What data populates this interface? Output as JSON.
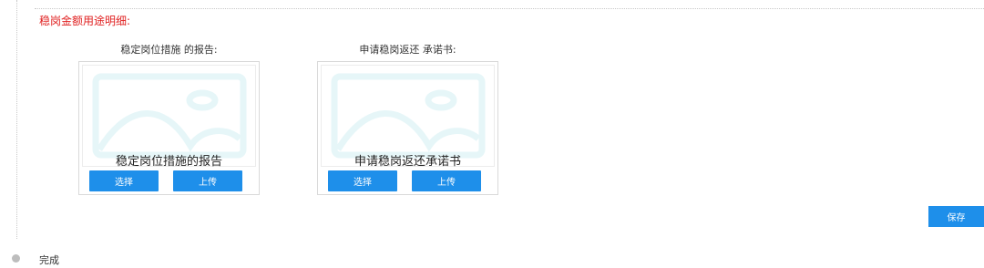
{
  "section": {
    "title": "稳岗金额用途明细:"
  },
  "cards": [
    {
      "label": "稳定岗位措施 的报告:",
      "caption": "稳定岗位措施的报告",
      "select_label": "选择",
      "upload_label": "上传",
      "icon": "image-placeholder-icon"
    },
    {
      "label": "申请稳岗返还 承诺书:",
      "caption": "申请稳岗返还承诺书",
      "select_label": "选择",
      "upload_label": "上传",
      "icon": "image-placeholder-icon"
    }
  ],
  "actions": {
    "save_label": "保存"
  },
  "timeline": {
    "step_label": "完成"
  },
  "colors": {
    "accent": "#1e8fea",
    "title_red": "#e02020",
    "placeholder": "#e6f6f8"
  }
}
